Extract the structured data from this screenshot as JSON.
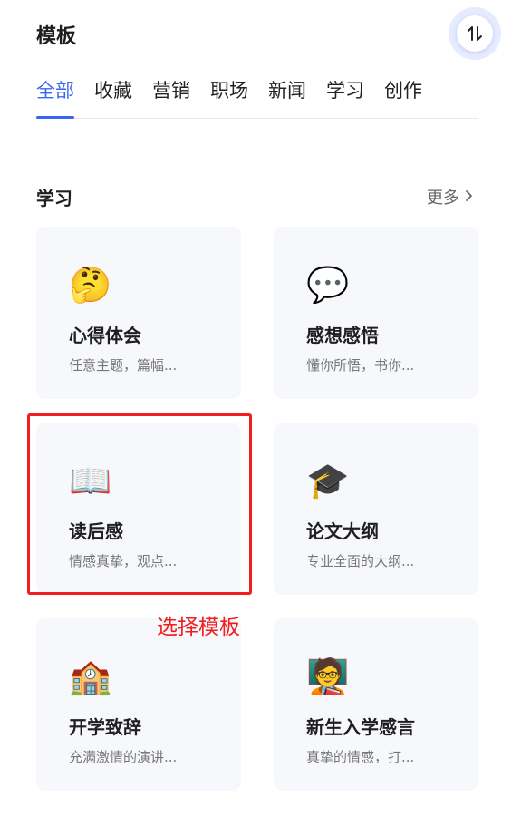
{
  "header": {
    "title": "模板",
    "sort_icon": "sort-arrows-icon"
  },
  "tabs": [
    {
      "label": "全部",
      "active": true
    },
    {
      "label": "收藏",
      "active": false
    },
    {
      "label": "营销",
      "active": false
    },
    {
      "label": "职场",
      "active": false
    },
    {
      "label": "新闻",
      "active": false
    },
    {
      "label": "学习",
      "active": false
    },
    {
      "label": "创作",
      "active": false
    }
  ],
  "section": {
    "title": "学习",
    "more_label": "更多",
    "more_icon": "chevron-right-icon"
  },
  "cards": [
    {
      "emoji": "🤔",
      "icon": "thinking-face-icon",
      "title": "心得体会",
      "desc": "任意主题，篇幅..."
    },
    {
      "emoji": "💬",
      "icon": "speech-bubble-icon",
      "title": "感想感悟",
      "desc": "懂你所悟，书你..."
    },
    {
      "emoji": "📖",
      "icon": "open-book-icon",
      "title": "读后感",
      "desc": "情感真挚，观点..."
    },
    {
      "emoji": "🎓",
      "icon": "graduation-cap-icon",
      "title": "论文大纲",
      "desc": "专业全面的大纲..."
    },
    {
      "emoji": "🏫",
      "icon": "school-building-icon",
      "title": "开学致辞",
      "desc": "充满激情的演讲..."
    },
    {
      "emoji": "🧑‍🏫",
      "icon": "teacher-icon",
      "title": "新生入学感言",
      "desc": "真挚的情感，打..."
    }
  ],
  "annotation": {
    "text": "选择模板",
    "color": "#f01e1e"
  },
  "colors": {
    "accent": "#3b66f5",
    "card_bg": "#f7f8fc",
    "highlight": "#f01e1e"
  }
}
